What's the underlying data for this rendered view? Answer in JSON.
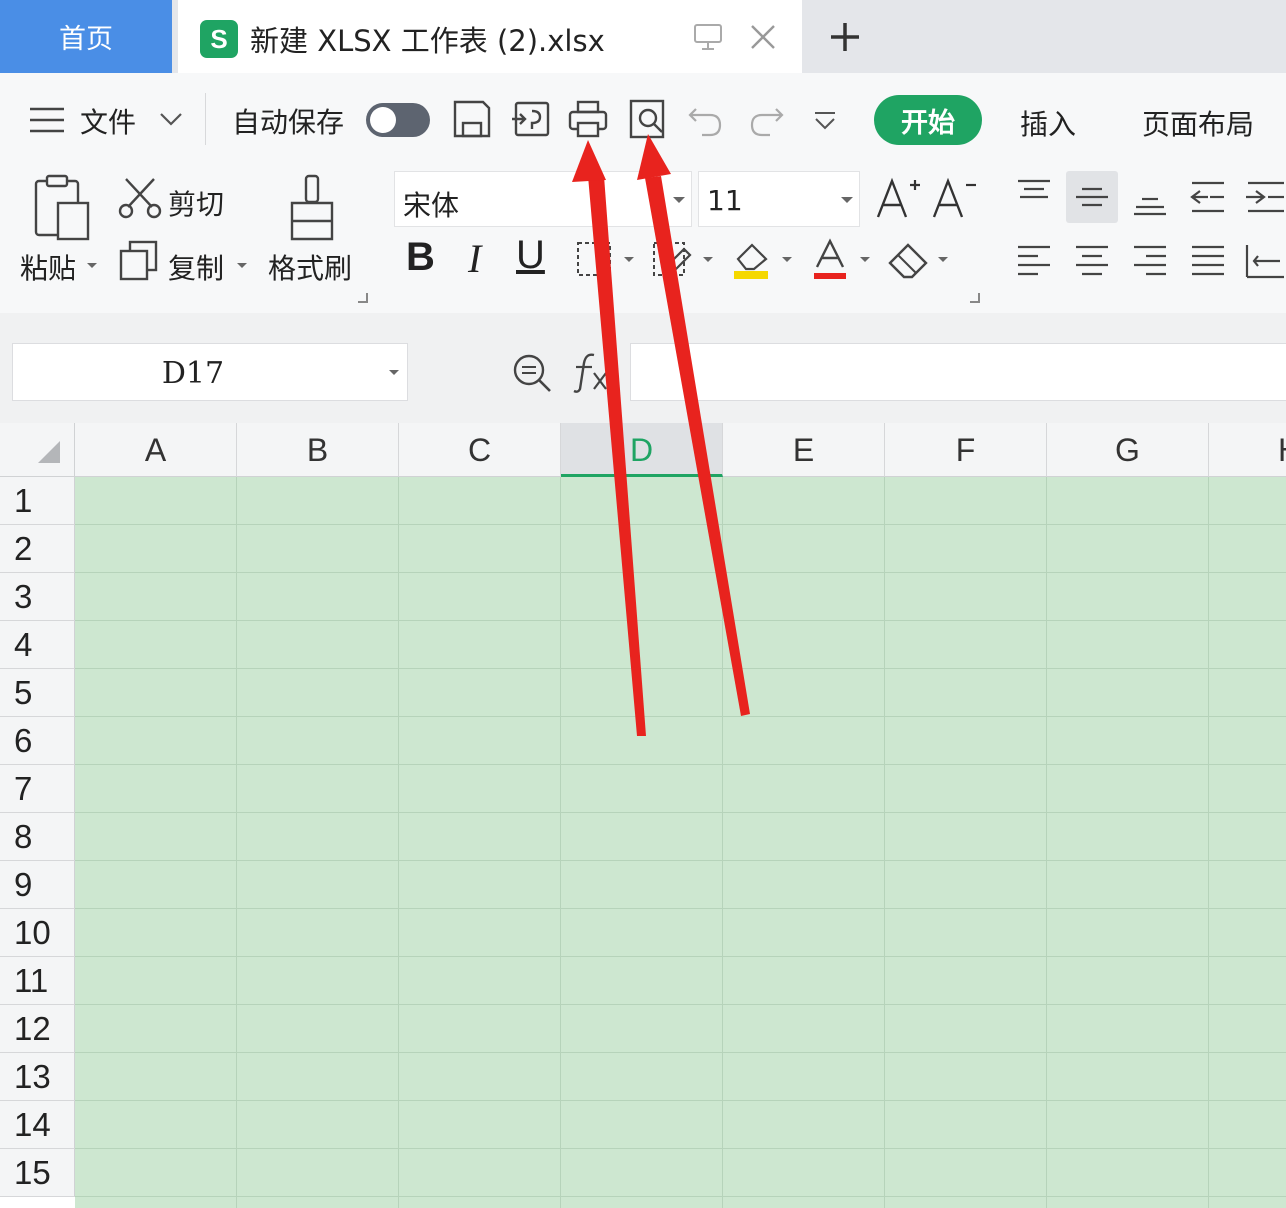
{
  "tabs": {
    "home_label": "首页",
    "doc_icon_letter": "S",
    "doc_title": "新建 XLSX 工作表 (2).xlsx"
  },
  "quick_access": {
    "file_label": "文件",
    "autosave_label": "自动保存",
    "autosave_on": false
  },
  "ribbon_tabs": {
    "active": "开始",
    "items": [
      "插入",
      "页面布局"
    ]
  },
  "ribbon": {
    "paste_label": "粘贴",
    "cut_label": "剪切",
    "copy_label": "复制",
    "format_painter_label": "格式刷",
    "font_name": "宋体",
    "font_size": "11",
    "bold_glyph": "B",
    "italic_glyph": "I",
    "underline_glyph": "U"
  },
  "formula_bar": {
    "cell_ref": "D17",
    "formula_value": ""
  },
  "grid": {
    "columns": [
      "A",
      "B",
      "C",
      "D",
      "E",
      "F",
      "G",
      "H"
    ],
    "active_column": "D",
    "rows": [
      "1",
      "2",
      "3",
      "4",
      "5",
      "6",
      "7",
      "8",
      "9",
      "10",
      "11",
      "12",
      "13",
      "14",
      "15"
    ],
    "fill_color": "#cde7d0"
  },
  "colors": {
    "accent_green": "#1fa463",
    "home_tab_blue": "#4a8ee6",
    "annotation_red": "#e8231e"
  }
}
